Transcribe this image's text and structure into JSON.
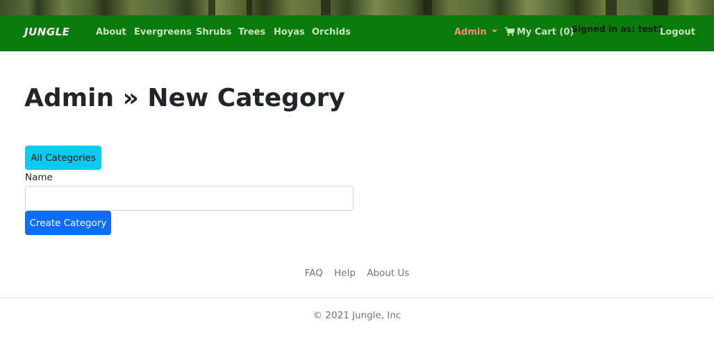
{
  "navbar": {
    "brand": "JUNGLE",
    "links": [
      "About",
      "Evergreens",
      "Shrubs",
      "Trees",
      "Hoyas",
      "Orchids"
    ],
    "admin_label": "Admin",
    "cart_label": "My Cart (0)",
    "signed_in": "Signed in as: test1",
    "logout_label": "Logout",
    "colors": {
      "bar": "#0a7a0a",
      "link": "#c9e3c0",
      "admin": "#f28b84"
    },
    "icons": {
      "cart": "shopping-cart-icon",
      "admin_dropdown": "caret-down-icon"
    }
  },
  "main": {
    "title": "Admin » New Category",
    "all_categories_label": "All Categories",
    "name_label": "Name",
    "name_value": "",
    "name_placeholder": "",
    "submit_label": "Create Category"
  },
  "footer": {
    "links": [
      "FAQ",
      "Help",
      "About Us"
    ],
    "copyright": "© 2021 Jungle, Inc"
  }
}
